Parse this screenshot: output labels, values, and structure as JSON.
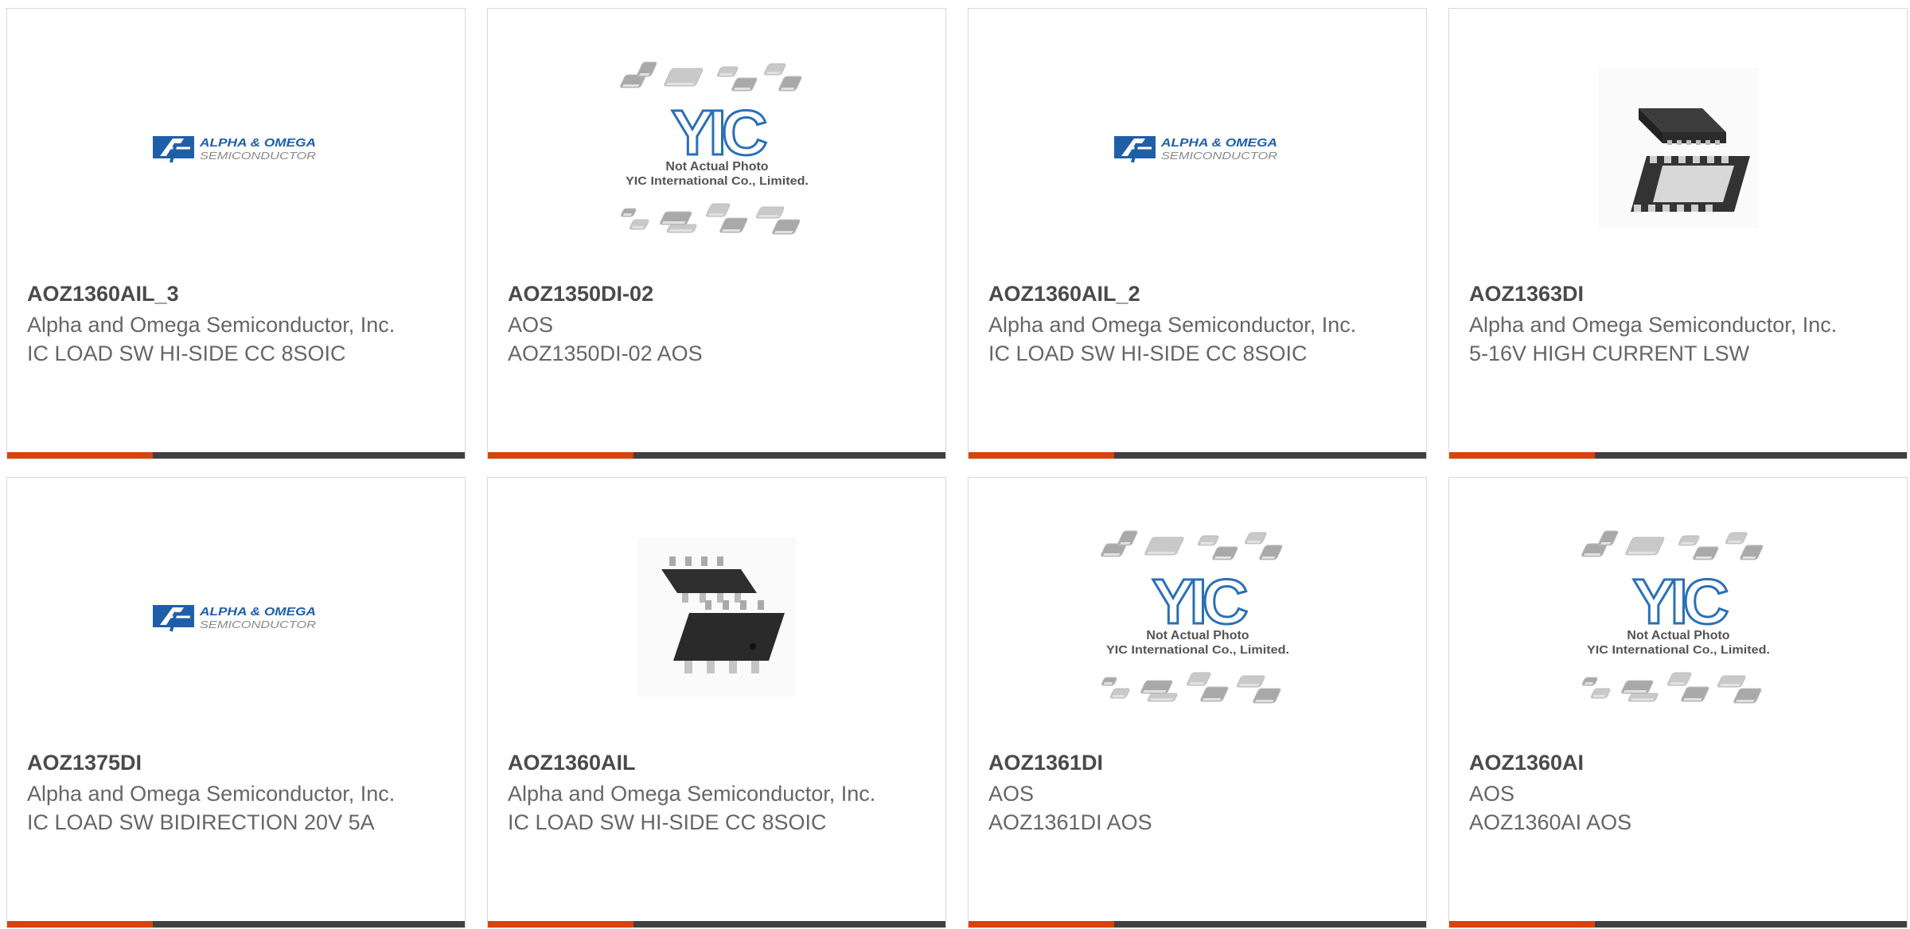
{
  "products": [
    {
      "part": "AOZ1360AIL_3",
      "manufacturer": "Alpha and Omega Semiconductor, Inc.",
      "description": "IC LOAD SW HI-SIDE CC 8SOIC",
      "image": {
        "type": "aos-logo",
        "line1": "ALPHA & OMEGA",
        "line2": "SEMICONDUCTOR"
      }
    },
    {
      "part": "AOZ1350DI-02",
      "manufacturer": "AOS",
      "description": "AOZ1350DI-02 AOS",
      "image": {
        "type": "yic-placeholder",
        "logo": "YIC",
        "line1": "Not Actual Photo",
        "line2": "YIC International Co., Limited."
      }
    },
    {
      "part": "AOZ1360AIL_2",
      "manufacturer": "Alpha and Omega Semiconductor, Inc.",
      "description": "IC LOAD SW HI-SIDE CC 8SOIC",
      "image": {
        "type": "aos-logo",
        "line1": "ALPHA & OMEGA",
        "line2": "SEMICONDUCTOR"
      }
    },
    {
      "part": "AOZ1363DI",
      "manufacturer": "Alpha and Omega Semiconductor, Inc.",
      "description": "5-16V HIGH CURRENT LSW",
      "image": {
        "type": "dfn-package"
      }
    },
    {
      "part": "AOZ1375DI",
      "manufacturer": "Alpha and Omega Semiconductor, Inc.",
      "description": "IC LOAD SW BIDIRECTION 20V 5A",
      "image": {
        "type": "aos-logo",
        "line1": "ALPHA & OMEGA",
        "line2": "SEMICONDUCTOR"
      }
    },
    {
      "part": "AOZ1360AIL",
      "manufacturer": "Alpha and Omega Semiconductor, Inc.",
      "description": "IC LOAD SW HI-SIDE CC 8SOIC",
      "image": {
        "type": "soic-package"
      }
    },
    {
      "part": "AOZ1361DI",
      "manufacturer": "AOS",
      "description": "AOZ1361DI AOS",
      "image": {
        "type": "yic-placeholder",
        "logo": "YIC",
        "line1": "Not Actual Photo",
        "line2": "YIC International Co., Limited."
      }
    },
    {
      "part": "AOZ1360AI",
      "manufacturer": "AOS",
      "description": "AOZ1360AI AOS",
      "image": {
        "type": "yic-placeholder",
        "logo": "YIC",
        "line1": "Not Actual Photo",
        "line2": "YIC International Co., Limited."
      }
    }
  ],
  "colors": {
    "accent": "#d9420b",
    "bar": "#404040",
    "title": "#4a4a4a",
    "text": "#666666",
    "logo_blue": "#1f5fa8"
  }
}
